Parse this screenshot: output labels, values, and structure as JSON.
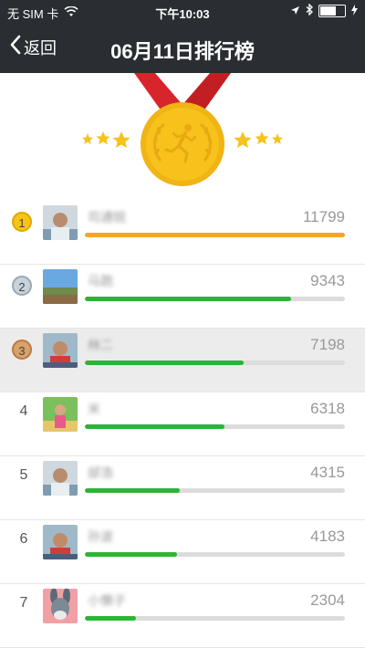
{
  "status_bar": {
    "carrier": "无 SIM 卡",
    "time": "下午10:03",
    "battery_level": 0.6
  },
  "header": {
    "back_label": "返回",
    "title": "06月11日排行榜"
  },
  "colors": {
    "bar_first": "#f5a623",
    "bar_default": "#2bb535",
    "badge_gold": "#f5c518",
    "badge_silver": "#c7d2da",
    "badge_bronze": "#d9a26a",
    "medal_gold": "#f6c21b",
    "ribbon_red": "#d7262b"
  },
  "max_steps": 11799,
  "ranking": [
    {
      "rank": "1",
      "name": "司通锐",
      "steps": "11799",
      "badge": "gold",
      "avatar_icon": "avatar-man-icon"
    },
    {
      "rank": "2",
      "name": "马跑",
      "steps": "9343",
      "badge": "silver",
      "avatar_icon": "avatar-landscape-icon"
    },
    {
      "rank": "3",
      "name": "林二",
      "steps": "7198",
      "badge": "bronze",
      "avatar_icon": "avatar-child-icon"
    },
    {
      "rank": "4",
      "name": "米",
      "steps": "6318",
      "badge": "",
      "avatar_icon": "avatar-girl-icon"
    },
    {
      "rank": "5",
      "name": "邰浩",
      "steps": "4315",
      "badge": "",
      "avatar_icon": "avatar-man-icon"
    },
    {
      "rank": "6",
      "name": "孙波",
      "steps": "4183",
      "badge": "",
      "avatar_icon": "avatar-child-icon"
    },
    {
      "rank": "7",
      "name": "小懒子",
      "steps": "2304",
      "badge": "",
      "avatar_icon": "avatar-donkey-icon"
    }
  ]
}
